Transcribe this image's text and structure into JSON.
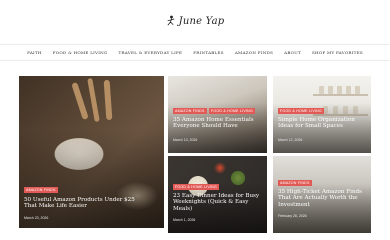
{
  "site": {
    "logo_text": "June Yap",
    "logo_icon": "figure-icon"
  },
  "nav": {
    "items": [
      "Faith",
      "Food & Home Living",
      "Travel & Everyday Life",
      "Printables",
      "Amazon Finds",
      "About",
      "Shop My Favorites"
    ]
  },
  "posts": [
    {
      "category": "Amazon Finds",
      "title": "50 Useful Amazon Products Under $25 That Make Life Easier",
      "date": "March 23, 2026"
    },
    {
      "category": "Amazon Finds",
      "category2": "Food & Home Living",
      "title": "35 Amazon Home Essentials Everyone Should Have",
      "date": "March 13, 2026"
    },
    {
      "category": "Food & Home Living",
      "title": "Simple Home Organization Ideas for Small Spaces",
      "date": "March 12, 2026"
    },
    {
      "category": "Food & Home Living",
      "title": "23 Easy Dinner Ideas for Busy Weeknights (Quick & Easy Meals)",
      "date": "March 1, 2026"
    },
    {
      "category": "Amazon Finds",
      "title": "35 High-Ticket Amazon Finds That Are Actually Worth the Investment",
      "date": "February 28, 2026"
    }
  ],
  "colors": {
    "accent": "#e25a56",
    "text": "#222222"
  }
}
